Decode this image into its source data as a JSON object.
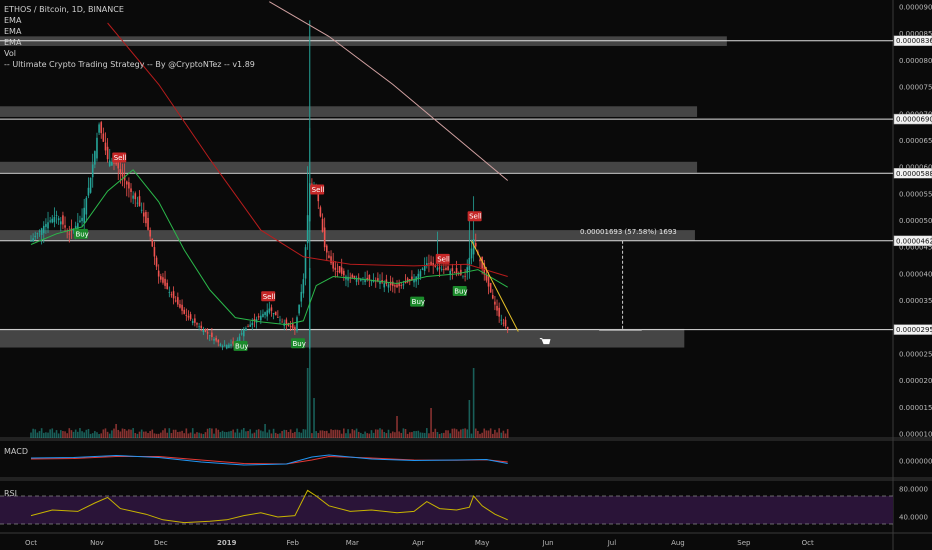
{
  "legend": {
    "symbol": "ETHOS / Bitcoin, 1D, BINANCE",
    "ema1": "EMA",
    "ema2": "EMA",
    "ema3": "EMA",
    "vol": "Vol",
    "strategy": "-- Ultimate Crypto Trading Strategy -- By @CryptoNTez -- v1.89"
  },
  "panes": {
    "macd": "MACD",
    "rsi": "RSI"
  },
  "colors": {
    "background": "#0a0a0a",
    "up": "#26a69a",
    "down": "#ef5350",
    "ema_fast": "#2bb84a",
    "ema_mid": "#b71c1c",
    "ema_slow": "#d0a0a0",
    "zone": "#5a5a5a",
    "buy": "#1b8a2b",
    "sell": "#c62828",
    "macd": "#2196f3",
    "signal": "#e53935",
    "rsi": "#c8b400",
    "rsi_band": "#2a1438"
  },
  "chart_data": {
    "type": "candlestick",
    "title": "ETHOS / Bitcoin, 1D, BINANCE",
    "y_ticks": [
      "0.00009000",
      "0.00008500",
      "0.00008000",
      "0.00007500",
      "0.00007000",
      "0.00006500",
      "0.00006000",
      "0.00005500",
      "0.00005000",
      "0.00004500",
      "0.00004000",
      "0.00003500",
      "0.00003000",
      "0.00002500",
      "0.00002000",
      "0.00001500",
      "0.00001000"
    ],
    "y_tick_values": [
      9e-05,
      8.5e-05,
      8e-05,
      7.5e-05,
      7e-05,
      6.5e-05,
      6e-05,
      5.5e-05,
      5e-05,
      4.5e-05,
      4e-05,
      3.5e-05,
      3e-05,
      2.5e-05,
      2e-05,
      1.5e-05,
      1e-05
    ],
    "x_ticks": [
      "Oct",
      "Nov",
      "Dec",
      "2019",
      "Feb",
      "Mar",
      "Apr",
      "May",
      "Jun",
      "Jul",
      "Aug",
      "Sep",
      "Oct"
    ],
    "x_tick_days": [
      0,
      31,
      61,
      92,
      123,
      151,
      182,
      212,
      243,
      273,
      304,
      335,
      365
    ],
    "price_tags": [
      {
        "label": "0.00008368",
        "value": 8.368e-05
      },
      {
        "label": "0.00006900",
        "value": 6.9e-05
      },
      {
        "label": "0.00005885",
        "value": 5.885e-05
      },
      {
        "label": "0.00004620",
        "value": 4.62e-05
      },
      {
        "label": "0.00002956",
        "value": 2.956e-05
      }
    ],
    "zones": [
      {
        "top": 8.45e-05,
        "bottom": 8.27e-05,
        "end_day": 327
      },
      {
        "top": 7.14e-05,
        "bottom": 6.94e-05,
        "end_day": 313
      },
      {
        "top": 6.1e-05,
        "bottom": 5.9e-05,
        "end_day": 313
      },
      {
        "top": 4.82e-05,
        "bottom": 4.63e-05,
        "end_day": 312
      },
      {
        "top": 2.97e-05,
        "bottom": 2.62e-05,
        "end_day": 307
      }
    ],
    "measure": {
      "label": "0.00001693 (57.58%) 1693",
      "day": 278,
      "from": 4.62e-05,
      "to": 2.956e-05
    },
    "signals": [
      {
        "type": "Buy",
        "day": 23,
        "price": 4.75e-05,
        "label": "Buy"
      },
      {
        "type": "Sell",
        "day": 41,
        "price": 6.18e-05,
        "label": "Sell"
      },
      {
        "type": "Buy",
        "day": 98,
        "price": 2.65e-05,
        "label": "Buy"
      },
      {
        "type": "Sell",
        "day": 111,
        "price": 3.58e-05,
        "label": "Sell"
      },
      {
        "type": "Buy",
        "day": 125,
        "price": 2.7e-05,
        "label": "Buy"
      },
      {
        "type": "Sell",
        "day": 134,
        "price": 5.58e-05,
        "label": "Sell"
      },
      {
        "type": "Buy",
        "day": 181,
        "price": 3.48e-05,
        "label": "Buy"
      },
      {
        "type": "Sell",
        "day": 193,
        "price": 4.28e-05,
        "label": "Sell"
      },
      {
        "type": "Buy",
        "day": 201,
        "price": 3.68e-05,
        "label": "Buy"
      },
      {
        "type": "Sell",
        "day": 208,
        "price": 5.08e-05,
        "label": "Sell"
      }
    ],
    "macd_tick": "0.00000000",
    "rsi_ticks": [
      "80.0000",
      "40.0000"
    ],
    "rsi_tick_values": [
      80,
      40
    ],
    "rsi_band": [
      70,
      30
    ],
    "price_points": [
      [
        0,
        4.62e-05
      ],
      [
        6,
        4.9e-05
      ],
      [
        12,
        5.1e-05
      ],
      [
        18,
        4.75e-05
      ],
      [
        24,
        5.05e-05
      ],
      [
        28,
        5.8e-05
      ],
      [
        32,
        6.8e-05
      ],
      [
        36,
        6.15e-05
      ],
      [
        40,
        6.05e-05
      ],
      [
        46,
        5.6e-05
      ],
      [
        52,
        5.2e-05
      ],
      [
        56,
        4.7e-05
      ],
      [
        60,
        3.95e-05
      ],
      [
        66,
        3.6e-05
      ],
      [
        72,
        3.25e-05
      ],
      [
        78,
        3.05e-05
      ],
      [
        84,
        2.85e-05
      ],
      [
        90,
        2.65e-05
      ],
      [
        96,
        2.7e-05
      ],
      [
        100,
        2.95e-05
      ],
      [
        106,
        3.15e-05
      ],
      [
        112,
        3.35e-05
      ],
      [
        118,
        3.1e-05
      ],
      [
        124,
        2.95e-05
      ],
      [
        128,
        3.9e-05
      ],
      [
        131,
        5.7e-05
      ],
      [
        134,
        5.65e-05
      ],
      [
        138,
        4.5e-05
      ],
      [
        142,
        4.1e-05
      ],
      [
        148,
        3.95e-05
      ],
      [
        156,
        3.9e-05
      ],
      [
        164,
        3.85e-05
      ],
      [
        172,
        3.75e-05
      ],
      [
        180,
        3.9e-05
      ],
      [
        186,
        4.2e-05
      ],
      [
        192,
        4.1e-05
      ],
      [
        198,
        4.05e-05
      ],
      [
        204,
        3.95e-05
      ],
      [
        208,
        4.65e-05
      ],
      [
        212,
        4.1e-05
      ],
      [
        216,
        3.65e-05
      ],
      [
        220,
        3.2e-05
      ],
      [
        224,
        2.96e-05
      ]
    ],
    "ema_fast": [
      [
        0,
        4.55e-05
      ],
      [
        12,
        4.75e-05
      ],
      [
        24,
        4.88e-05
      ],
      [
        36,
        5.55e-05
      ],
      [
        48,
        5.95e-05
      ],
      [
        60,
        5.35e-05
      ],
      [
        72,
        4.45e-05
      ],
      [
        84,
        3.7e-05
      ],
      [
        96,
        3.18e-05
      ],
      [
        108,
        3.1e-05
      ],
      [
        120,
        3.05e-05
      ],
      [
        128,
        3.12e-05
      ],
      [
        134,
        3.78e-05
      ],
      [
        142,
        3.95e-05
      ],
      [
        156,
        3.9e-05
      ],
      [
        172,
        3.82e-05
      ],
      [
        186,
        3.95e-05
      ],
      [
        200,
        4e-05
      ],
      [
        210,
        4.08e-05
      ],
      [
        224,
        3.75e-05
      ]
    ],
    "ema_mid": [
      [
        36,
        8.7e-05
      ],
      [
        60,
        7.55e-05
      ],
      [
        84,
        6.15e-05
      ],
      [
        108,
        4.82e-05
      ],
      [
        128,
        4.32e-05
      ],
      [
        150,
        4.18e-05
      ],
      [
        180,
        4.15e-05
      ],
      [
        205,
        4.18e-05
      ],
      [
        224,
        3.95e-05
      ]
    ],
    "ema_slow": [
      [
        112,
        9.1e-05
      ],
      [
        140,
        8.45e-05
      ],
      [
        170,
        7.55e-05
      ],
      [
        200,
        6.55e-05
      ],
      [
        224,
        5.75e-05
      ]
    ],
    "trend_line": [
      [
        207,
        4.62e-05
      ],
      [
        229,
        2.92e-05
      ]
    ],
    "macd_line": [
      [
        0,
        0.3
      ],
      [
        20,
        0.35
      ],
      [
        40,
        0.55
      ],
      [
        60,
        0.35
      ],
      [
        80,
        -0.1
      ],
      [
        100,
        -0.4
      ],
      [
        120,
        -0.3
      ],
      [
        132,
        0.4
      ],
      [
        140,
        0.6
      ],
      [
        160,
        0.2
      ],
      [
        180,
        0.05
      ],
      [
        200,
        0.1
      ],
      [
        214,
        0.15
      ],
      [
        224,
        -0.25
      ]
    ],
    "signal_line": [
      [
        0,
        0.2
      ],
      [
        20,
        0.25
      ],
      [
        40,
        0.45
      ],
      [
        60,
        0.45
      ],
      [
        80,
        0.1
      ],
      [
        100,
        -0.25
      ],
      [
        120,
        -0.3
      ],
      [
        132,
        0.1
      ],
      [
        140,
        0.45
      ],
      [
        160,
        0.3
      ],
      [
        180,
        0.1
      ],
      [
        200,
        0.08
      ],
      [
        214,
        0.12
      ],
      [
        224,
        -0.1
      ]
    ],
    "rsi_line": [
      [
        0,
        42
      ],
      [
        10,
        50
      ],
      [
        22,
        48
      ],
      [
        30,
        60
      ],
      [
        36,
        68
      ],
      [
        42,
        52
      ],
      [
        54,
        44
      ],
      [
        62,
        36
      ],
      [
        72,
        32
      ],
      [
        84,
        34
      ],
      [
        92,
        36
      ],
      [
        100,
        42
      ],
      [
        108,
        46
      ],
      [
        116,
        40
      ],
      [
        124,
        42
      ],
      [
        130,
        78
      ],
      [
        134,
        70
      ],
      [
        140,
        56
      ],
      [
        150,
        48
      ],
      [
        160,
        50
      ],
      [
        172,
        46
      ],
      [
        180,
        48
      ],
      [
        186,
        62
      ],
      [
        192,
        52
      ],
      [
        200,
        50
      ],
      [
        206,
        54
      ],
      [
        208,
        70
      ],
      [
        212,
        56
      ],
      [
        218,
        44
      ],
      [
        224,
        36
      ]
    ]
  }
}
